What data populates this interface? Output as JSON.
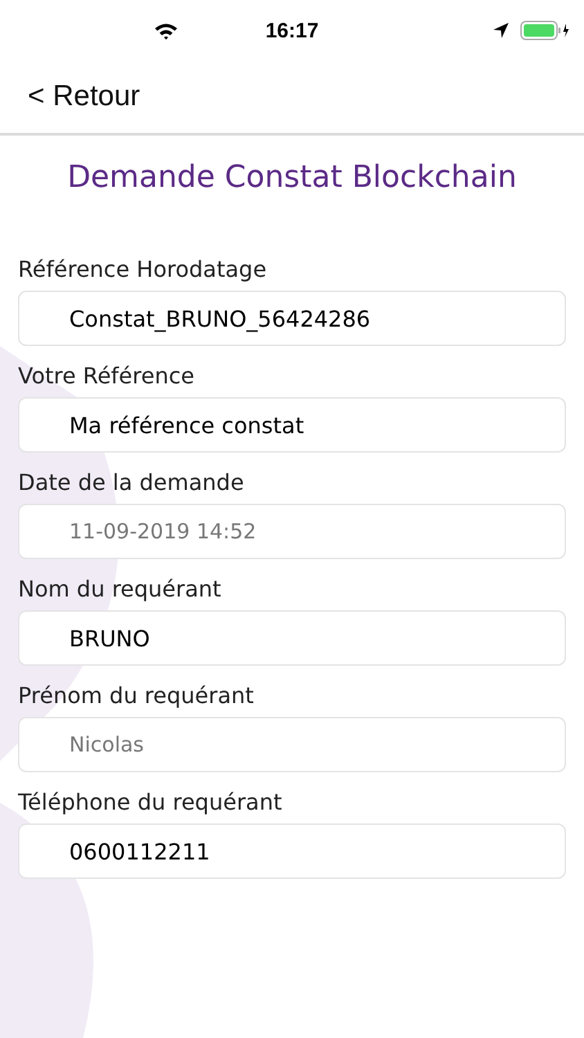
{
  "status_bar": {
    "time": "16:17"
  },
  "nav": {
    "back": "< Retour"
  },
  "title": "Demande Constat Blockchain",
  "fields": [
    {
      "label": "Référence Horodatage",
      "value": "Constat_BRUNO_56424286",
      "disabled": false
    },
    {
      "label": "Votre Référence",
      "value": "Ma référence constat",
      "disabled": false
    },
    {
      "label": "Date de la demande",
      "value": "11-09-2019 14:52",
      "disabled": true
    },
    {
      "label": "Nom du requérant",
      "value": "BRUNO",
      "disabled": false
    },
    {
      "label": "Prénom du requérant",
      "value": "Nicolas",
      "disabled": true
    },
    {
      "label": "Téléphone du requérant",
      "value": "0600112211",
      "disabled": false
    }
  ]
}
